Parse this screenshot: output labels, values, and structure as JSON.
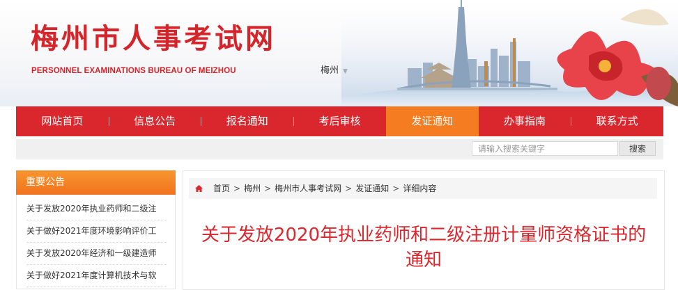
{
  "header": {
    "title": "梅州市人事考试网",
    "subtitle": "PERSONNEL EXAMINATIONS BUREAU OF MEIZHOU",
    "city_select": "梅州"
  },
  "nav": {
    "items": [
      "网站首页",
      "信息公告",
      "报名通知",
      "考后审核",
      "发证通知",
      "办事指南",
      "联系方式"
    ],
    "active": "发证通知"
  },
  "search": {
    "placeholder": "请输入搜索关键字",
    "button": "搜索"
  },
  "sidebar": {
    "heading": "重要公告",
    "items": [
      "关于发放2020年执业药师和二级注",
      "关于做好2021年度环境影响评价工",
      "关于发放2020年经济和一级建造师",
      "关于做好2021年度计算机技术与软"
    ]
  },
  "breadcrumb": [
    "首页",
    "梅州",
    "梅州市人事考试网",
    "发证通知",
    "详细内容"
  ],
  "breadcrumb_separator": ">",
  "article": {
    "title": "关于发放2020年执业药师和二级注册计量师资格证书的通知"
  },
  "colors": {
    "brand_red": "#d9272d",
    "active_orange": "#f57c21"
  },
  "icons": {
    "home": "home-icon",
    "caret": "chevron-down-icon"
  }
}
